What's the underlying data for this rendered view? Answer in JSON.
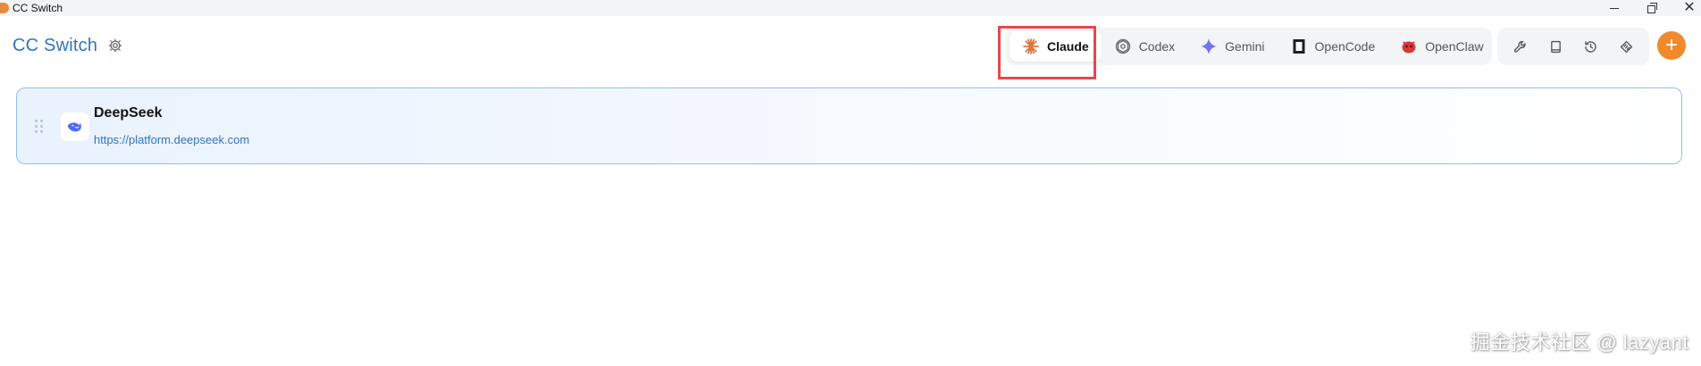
{
  "window": {
    "title": "CC Switch",
    "controls": [
      "minimize",
      "restore",
      "close"
    ],
    "close_glyph": "✕"
  },
  "header": {
    "brand": "CC Switch",
    "settings_icon": "gear-icon",
    "tabs": [
      {
        "label": "Claude",
        "icon": "claude-icon",
        "active": true
      },
      {
        "label": "Codex",
        "icon": "codex-icon",
        "active": false
      },
      {
        "label": "Gemini",
        "icon": "gemini-icon",
        "active": false
      },
      {
        "label": "OpenCode",
        "icon": "opencode-icon",
        "active": false
      },
      {
        "label": "OpenClaw",
        "icon": "openclaw-icon",
        "active": false
      }
    ],
    "tools": [
      "wrench-icon",
      "book-icon",
      "history-icon",
      "layers-icon"
    ],
    "add_label": "+"
  },
  "providers": [
    {
      "name": "DeepSeek",
      "url": "https://platform.deepseek.com",
      "icon": "deepseek-whale-icon"
    }
  ],
  "watermark": "掘金技术社区 @ lazyant",
  "colors": {
    "brand": "#2f74c0",
    "accent": "#f08a2c",
    "highlight": "#e5484d",
    "card_border": "#8ec1ea"
  }
}
